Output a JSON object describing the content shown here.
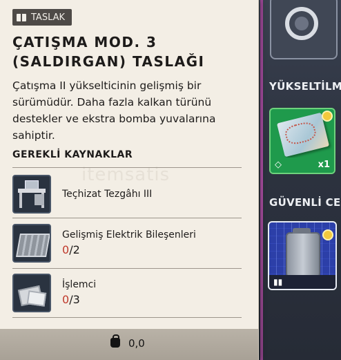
{
  "tooltip": {
    "tag_label": "TASLAK",
    "title": "ÇATIŞMA MOD. 3 (SALDIRGAN) TASLAĞI",
    "description": "Çatışma II yükselticinin gelişmiş bir sürümüdür. Daha fazla kalkan türünü destekler ve ekstra bomba yuvalarına sahiptir.",
    "requirements_heading": "GEREKLİ KAYNAKLAR",
    "resources": [
      {
        "name": "Teçhizat Tezgâhı III",
        "icon": "workbench-icon"
      },
      {
        "name": "Gelişmiş Elektrik Bileşenleri",
        "have": "0",
        "need": "/2",
        "icon": "electrical-components-icon"
      },
      {
        "name": "İşlemci",
        "have": "0",
        "need": "/3",
        "icon": "processor-icon"
      }
    ],
    "footer_weight": "0,0",
    "watermark": "itemsatis"
  },
  "background": {
    "section_upgrades": "YÜKSELTİLMİ",
    "section_safe": "GÜVENLİ CEP",
    "map_item_qty": "x1",
    "accent_green": "#1f9a4c",
    "accent_blue": "#2e43ad",
    "have_color": "#c0392b"
  }
}
